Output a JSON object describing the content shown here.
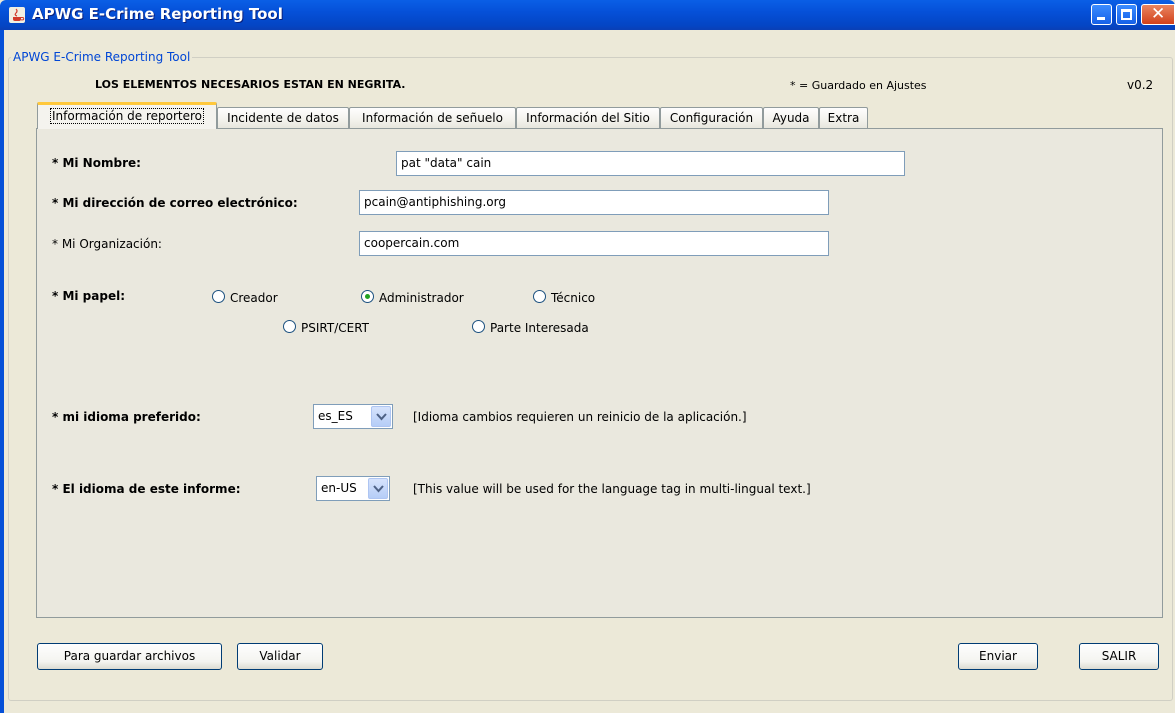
{
  "window": {
    "title": "APWG E-Crime Reporting Tool"
  },
  "group_title": "APWG E-Crime Reporting Tool",
  "header": {
    "required_note": "LOS ELEMENTOS NECESARIOS ESTAN EN NEGRITA.",
    "saved_note": "* = Guardado en Ajustes",
    "version": "v0.2"
  },
  "tabs": [
    {
      "label": "Información de reportero",
      "active": true
    },
    {
      "label": "Incidente de datos"
    },
    {
      "label": "Información de señuelo"
    },
    {
      "label": "Información del Sitio"
    },
    {
      "label": "Configuración"
    },
    {
      "label": "Ayuda"
    },
    {
      "label": "Extra"
    }
  ],
  "form": {
    "name_label": "* Mi Nombre:",
    "name_value": "pat \"data\" cain",
    "email_label": "* Mi dirección de correo electrónico:",
    "email_value": "pcain@antiphishing.org",
    "org_label": "* Mi Organización:",
    "org_value": "coopercain.com",
    "role_label": "* Mi papel:",
    "roles": [
      {
        "label": "Creador",
        "selected": false
      },
      {
        "label": "Administrador",
        "selected": true
      },
      {
        "label": "Técnico",
        "selected": false
      },
      {
        "label": "PSIRT/CERT",
        "selected": false
      },
      {
        "label": "Parte Interesada",
        "selected": false
      }
    ],
    "lang_label": "* mi idioma preferido:",
    "lang_value": "es_ES",
    "lang_note": "[Idioma cambios requieren un reinicio de la aplicación.]",
    "report_lang_label": "* El idioma de este informe:",
    "report_lang_value": "en-US",
    "report_lang_note": "[This value will be used for the language tag in multi-lingual text.]"
  },
  "buttons": {
    "save": "Para guardar archivos",
    "validate": "Validar",
    "send": "Enviar",
    "exit": "SALIR"
  },
  "colors": {
    "titlebar": "#0550d8",
    "window_bg": "#ece9d8",
    "group_title": "#0046d5",
    "active_tab_accent": "#ffc83c"
  }
}
